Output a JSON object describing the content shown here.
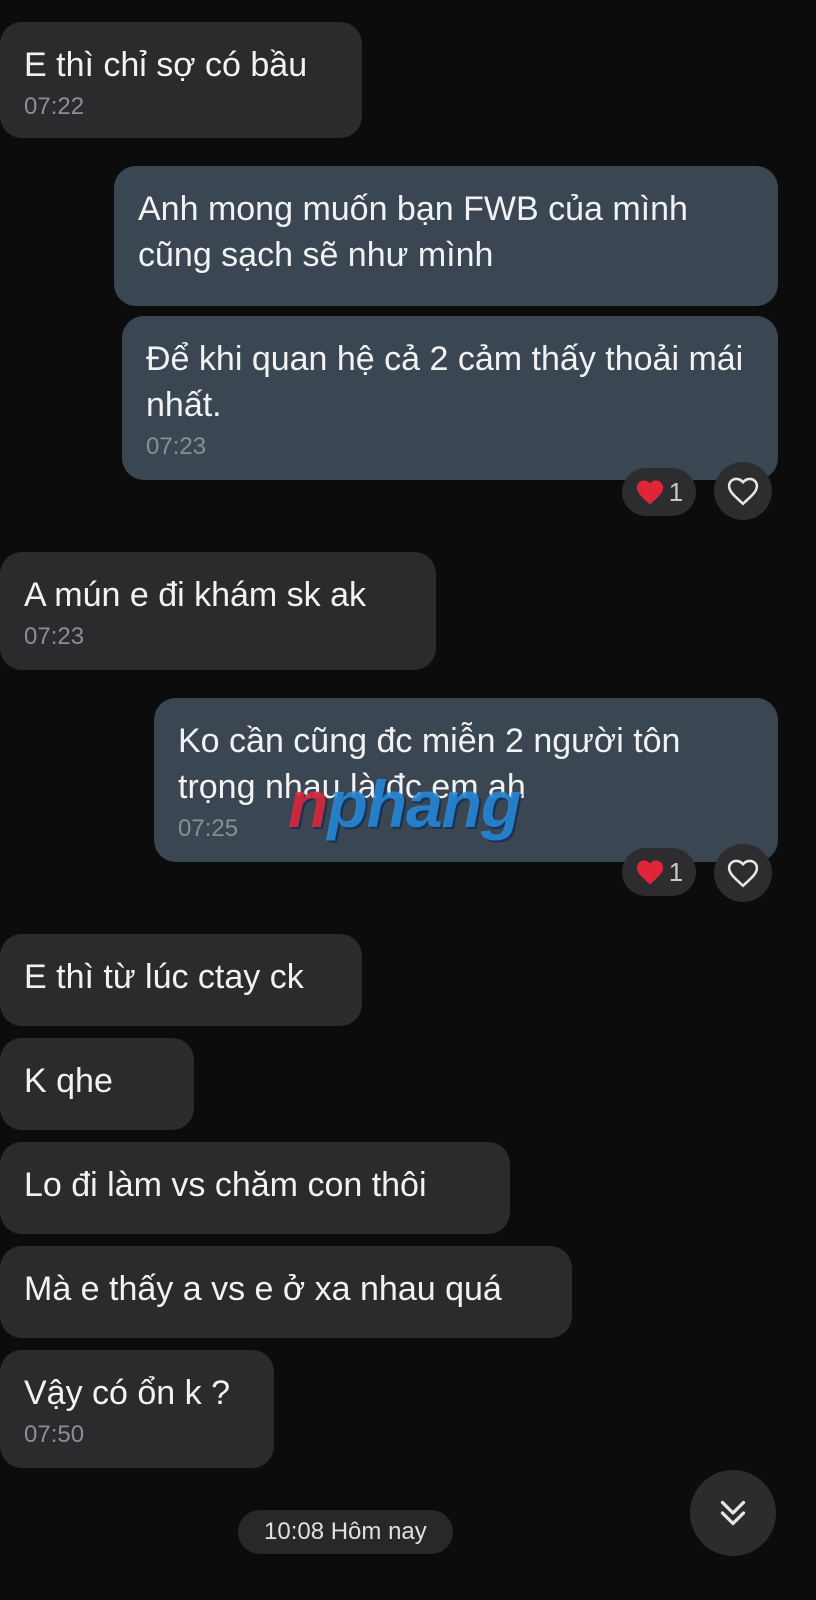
{
  "messages": [
    {
      "text": "E thì chỉ sợ có bầu",
      "time": "07:22"
    },
    {
      "text": "Anh mong muốn bạn FWB của mình cũng sạch sẽ như mình"
    },
    {
      "text": "Để khi quan hệ cả 2 cảm thấy thoải mái nhất.",
      "time": "07:23",
      "reaction_count": "1"
    },
    {
      "text": "A mún e đi khám sk ak",
      "time": "07:23"
    },
    {
      "text": "Ko cần cũng đc miễn 2 người tôn trọng nhau là đc em ah",
      "time": "07:25",
      "reaction_count": "1"
    },
    {
      "text": "E thì từ lúc ctay ck"
    },
    {
      "text": "K qhe"
    },
    {
      "text": "Lo đi làm vs chăm con thôi"
    },
    {
      "text": "Mà e thấy a vs e ở xa nhau quá"
    },
    {
      "text": "Vậy có ổn k ?",
      "time": "07:50"
    }
  ],
  "watermark": {
    "red": "n",
    "blue": "phang"
  },
  "date_separator": "10:08 Hôm nay",
  "colors": {
    "background": "#0c0c0d",
    "incoming_bubble": "#2b2b2d",
    "outgoing_bubble": "#3a4652",
    "timestamp": "#8a8f96",
    "heart": "#e0243a"
  }
}
